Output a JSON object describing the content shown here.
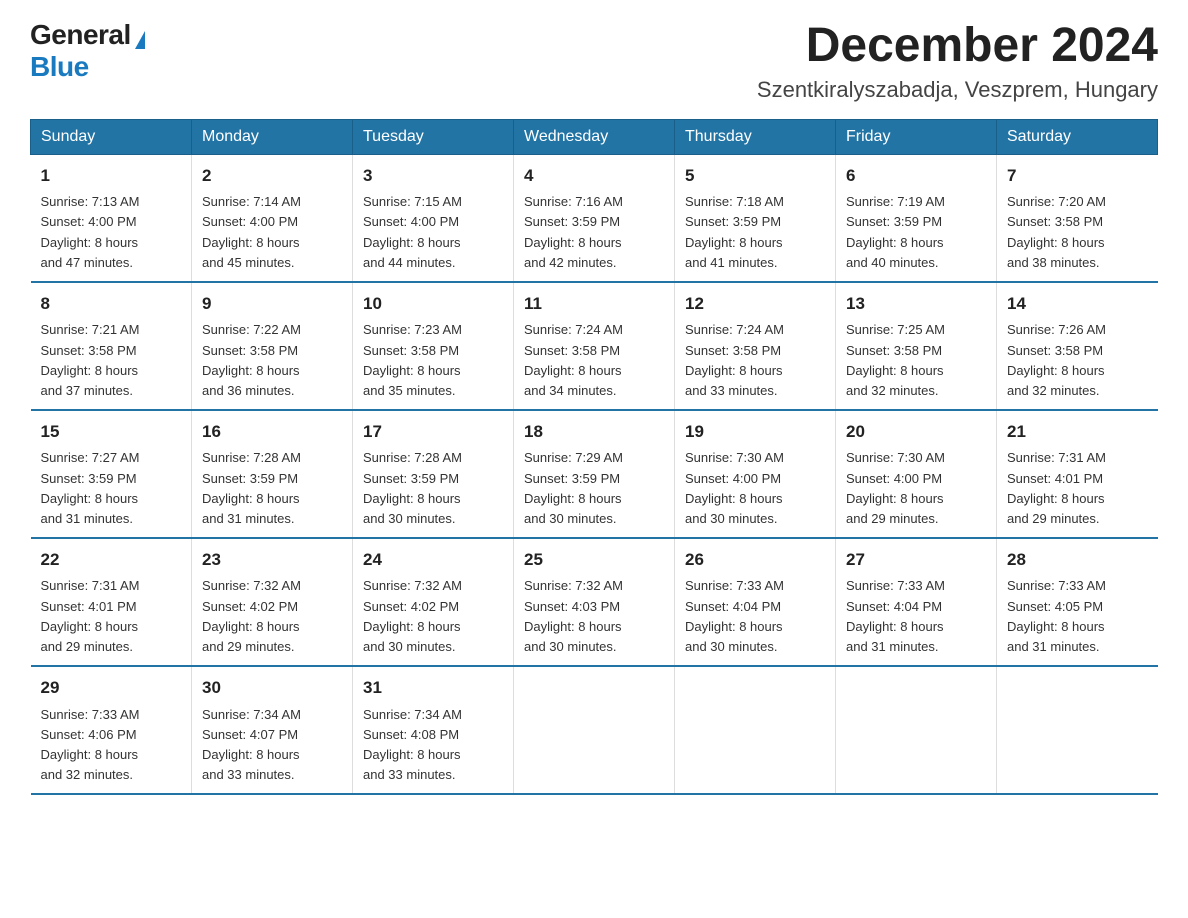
{
  "header": {
    "logo_general": "General",
    "logo_blue": "Blue",
    "month_title": "December 2024",
    "location": "Szentkiralyszabadja, Veszprem, Hungary"
  },
  "weekdays": [
    "Sunday",
    "Monday",
    "Tuesday",
    "Wednesday",
    "Thursday",
    "Friday",
    "Saturday"
  ],
  "weeks": [
    [
      {
        "day": "1",
        "sunrise": "7:13 AM",
        "sunset": "4:00 PM",
        "daylight": "8 hours and 47 minutes."
      },
      {
        "day": "2",
        "sunrise": "7:14 AM",
        "sunset": "4:00 PM",
        "daylight": "8 hours and 45 minutes."
      },
      {
        "day": "3",
        "sunrise": "7:15 AM",
        "sunset": "4:00 PM",
        "daylight": "8 hours and 44 minutes."
      },
      {
        "day": "4",
        "sunrise": "7:16 AM",
        "sunset": "3:59 PM",
        "daylight": "8 hours and 42 minutes."
      },
      {
        "day": "5",
        "sunrise": "7:18 AM",
        "sunset": "3:59 PM",
        "daylight": "8 hours and 41 minutes."
      },
      {
        "day": "6",
        "sunrise": "7:19 AM",
        "sunset": "3:59 PM",
        "daylight": "8 hours and 40 minutes."
      },
      {
        "day": "7",
        "sunrise": "7:20 AM",
        "sunset": "3:58 PM",
        "daylight": "8 hours and 38 minutes."
      }
    ],
    [
      {
        "day": "8",
        "sunrise": "7:21 AM",
        "sunset": "3:58 PM",
        "daylight": "8 hours and 37 minutes."
      },
      {
        "day": "9",
        "sunrise": "7:22 AM",
        "sunset": "3:58 PM",
        "daylight": "8 hours and 36 minutes."
      },
      {
        "day": "10",
        "sunrise": "7:23 AM",
        "sunset": "3:58 PM",
        "daylight": "8 hours and 35 minutes."
      },
      {
        "day": "11",
        "sunrise": "7:24 AM",
        "sunset": "3:58 PM",
        "daylight": "8 hours and 34 minutes."
      },
      {
        "day": "12",
        "sunrise": "7:24 AM",
        "sunset": "3:58 PM",
        "daylight": "8 hours and 33 minutes."
      },
      {
        "day": "13",
        "sunrise": "7:25 AM",
        "sunset": "3:58 PM",
        "daylight": "8 hours and 32 minutes."
      },
      {
        "day": "14",
        "sunrise": "7:26 AM",
        "sunset": "3:58 PM",
        "daylight": "8 hours and 32 minutes."
      }
    ],
    [
      {
        "day": "15",
        "sunrise": "7:27 AM",
        "sunset": "3:59 PM",
        "daylight": "8 hours and 31 minutes."
      },
      {
        "day": "16",
        "sunrise": "7:28 AM",
        "sunset": "3:59 PM",
        "daylight": "8 hours and 31 minutes."
      },
      {
        "day": "17",
        "sunrise": "7:28 AM",
        "sunset": "3:59 PM",
        "daylight": "8 hours and 30 minutes."
      },
      {
        "day": "18",
        "sunrise": "7:29 AM",
        "sunset": "3:59 PM",
        "daylight": "8 hours and 30 minutes."
      },
      {
        "day": "19",
        "sunrise": "7:30 AM",
        "sunset": "4:00 PM",
        "daylight": "8 hours and 30 minutes."
      },
      {
        "day": "20",
        "sunrise": "7:30 AM",
        "sunset": "4:00 PM",
        "daylight": "8 hours and 29 minutes."
      },
      {
        "day": "21",
        "sunrise": "7:31 AM",
        "sunset": "4:01 PM",
        "daylight": "8 hours and 29 minutes."
      }
    ],
    [
      {
        "day": "22",
        "sunrise": "7:31 AM",
        "sunset": "4:01 PM",
        "daylight": "8 hours and 29 minutes."
      },
      {
        "day": "23",
        "sunrise": "7:32 AM",
        "sunset": "4:02 PM",
        "daylight": "8 hours and 29 minutes."
      },
      {
        "day": "24",
        "sunrise": "7:32 AM",
        "sunset": "4:02 PM",
        "daylight": "8 hours and 30 minutes."
      },
      {
        "day": "25",
        "sunrise": "7:32 AM",
        "sunset": "4:03 PM",
        "daylight": "8 hours and 30 minutes."
      },
      {
        "day": "26",
        "sunrise": "7:33 AM",
        "sunset": "4:04 PM",
        "daylight": "8 hours and 30 minutes."
      },
      {
        "day": "27",
        "sunrise": "7:33 AM",
        "sunset": "4:04 PM",
        "daylight": "8 hours and 31 minutes."
      },
      {
        "day": "28",
        "sunrise": "7:33 AM",
        "sunset": "4:05 PM",
        "daylight": "8 hours and 31 minutes."
      }
    ],
    [
      {
        "day": "29",
        "sunrise": "7:33 AM",
        "sunset": "4:06 PM",
        "daylight": "8 hours and 32 minutes."
      },
      {
        "day": "30",
        "sunrise": "7:34 AM",
        "sunset": "4:07 PM",
        "daylight": "8 hours and 33 minutes."
      },
      {
        "day": "31",
        "sunrise": "7:34 AM",
        "sunset": "4:08 PM",
        "daylight": "8 hours and 33 minutes."
      },
      null,
      null,
      null,
      null
    ]
  ],
  "labels": {
    "sunrise": "Sunrise:",
    "sunset": "Sunset:",
    "daylight": "Daylight:"
  }
}
